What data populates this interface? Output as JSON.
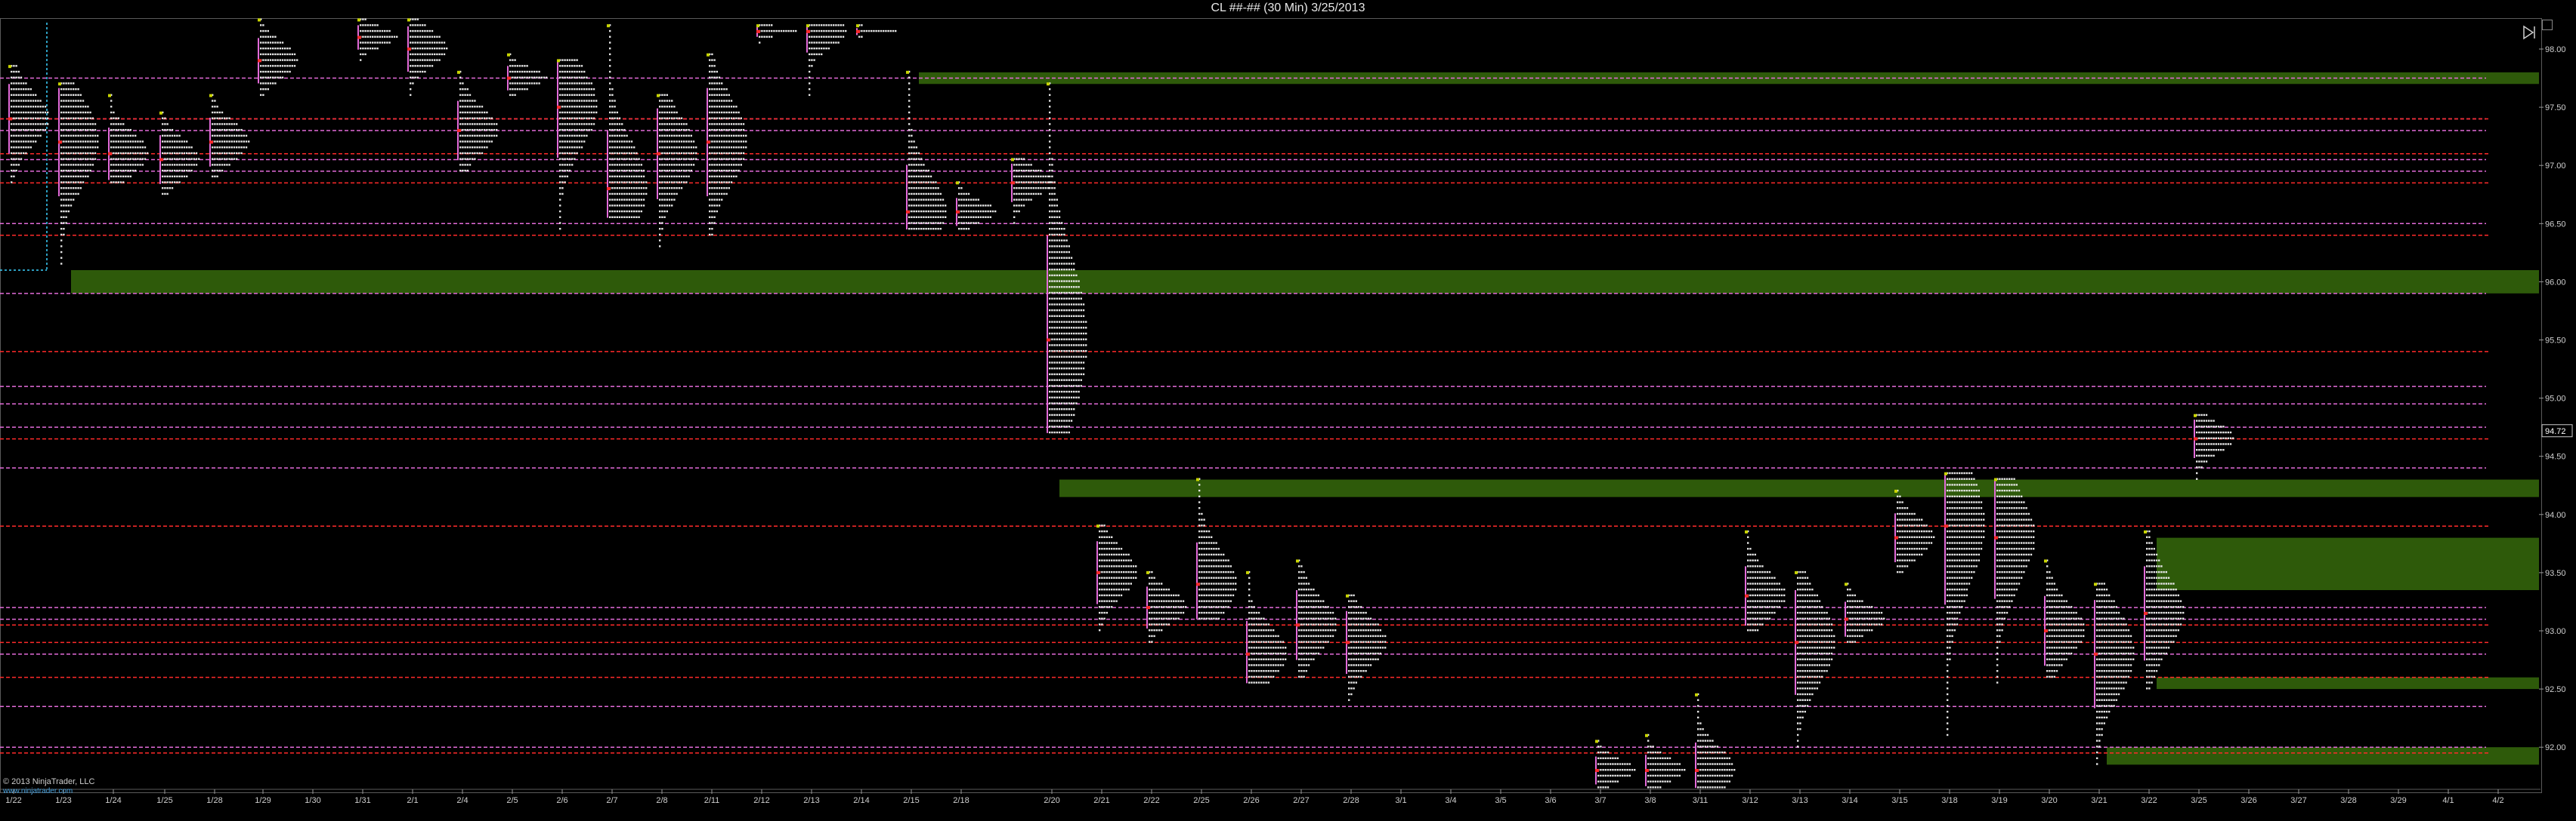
{
  "window": {
    "title": "CL ##-## (30 Min)  3/25/2013"
  },
  "footer": {
    "copyright": "© 2013 NinjaTrader, LLC",
    "watermark": "www.ninjatrader.com"
  },
  "colors": {
    "background": "#000000",
    "dots": "#e6e6e6",
    "poc": "#ff2a2a",
    "value_area": "#e36bd9",
    "range_band": "#2e5a0a",
    "open_tick": "#c8d400",
    "grid": "#5a5a5a"
  },
  "chart_data": {
    "type": "market_profile",
    "instrument": "CL ##-##",
    "interval": "30 Min",
    "date": "3/25/2013",
    "y_axis": {
      "ticks": [
        "98.00",
        "97.50",
        "97.00",
        "96.50",
        "96.00",
        "95.50",
        "95.00",
        "94.50",
        "94.00",
        "93.50",
        "93.00",
        "92.50",
        "92.00"
      ],
      "ylim": [
        91.65,
        98.2
      ]
    },
    "current_price": "94.72",
    "x_axis": {
      "labels": [
        "1/22",
        "1/23",
        "1/24",
        "1/25",
        "1/28",
        "1/29",
        "1/30",
        "1/31",
        "2/1",
        "2/4",
        "2/5",
        "2/6",
        "2/7",
        "2/8",
        "2/11",
        "2/12",
        "2/13",
        "2/14",
        "2/15",
        "2/18",
        "2/20",
        "2/21",
        "2/22",
        "2/25",
        "2/26",
        "2/27",
        "2/28",
        "3/1",
        "3/4",
        "3/5",
        "3/6",
        "3/7",
        "3/8",
        "3/11",
        "3/12",
        "3/13",
        "3/14",
        "3/15",
        "3/18",
        "3/19",
        "3/20",
        "3/21",
        "3/22",
        "3/25",
        "3/26",
        "3/27",
        "3/28",
        "3/29",
        "4/1",
        "4/2"
      ]
    },
    "profiles": [
      {
        "date": "1/22",
        "low": 96.85,
        "high": 97.85,
        "poc": 97.4
      },
      {
        "date": "1/23",
        "low": 96.15,
        "high": 97.7,
        "poc": 97.2
      },
      {
        "date": "1/24",
        "low": 96.85,
        "high": 97.6,
        "poc": 97.1
      },
      {
        "date": "1/25",
        "low": 96.75,
        "high": 97.45,
        "poc": 97.05
      },
      {
        "date": "1/28",
        "low": 96.9,
        "high": 97.6,
        "poc": 97.2
      },
      {
        "date": "1/29",
        "low": 97.6,
        "high": 98.25,
        "poc": 97.9
      },
      {
        "date": "1/31",
        "low": 97.9,
        "high": 98.25,
        "poc": 98.1
      },
      {
        "date": "2/1",
        "low": 97.6,
        "high": 98.25,
        "poc": 98.0
      },
      {
        "date": "2/4",
        "low": 96.95,
        "high": 97.8,
        "poc": 97.3
      },
      {
        "date": "2/5",
        "low": 97.6,
        "high": 97.95,
        "poc": 97.75
      },
      {
        "date": "2/6",
        "low": 96.45,
        "high": 97.9,
        "poc": 97.5
      },
      {
        "date": "2/7",
        "low": 96.55,
        "high": 98.2,
        "poc": 96.8
      },
      {
        "date": "2/8",
        "low": 96.3,
        "high": 97.6,
        "poc": 97.1
      },
      {
        "date": "2/11",
        "low": 96.4,
        "high": 97.95,
        "poc": 97.2
      },
      {
        "date": "2/12",
        "low": 98.05,
        "high": 98.2,
        "poc": 98.15
      },
      {
        "date": "2/13",
        "low": 97.6,
        "high": 98.2,
        "poc": 98.15
      },
      {
        "date": "2/14",
        "low": 98.1,
        "high": 98.2,
        "poc": 98.15
      },
      {
        "date": "2/15",
        "low": 96.45,
        "high": 97.8,
        "poc": 96.6
      },
      {
        "date": "2/18",
        "low": 96.45,
        "high": 96.85,
        "poc": 96.6
      },
      {
        "date": "2/19",
        "low": 96.5,
        "high": 97.05,
        "poc": 96.85
      },
      {
        "date": "2/20",
        "low": 94.7,
        "high": 97.7,
        "poc": 95.5
      },
      {
        "date": "2/21",
        "low": 93.0,
        "high": 93.9,
        "poc": 93.5
      },
      {
        "date": "2/22",
        "low": 92.9,
        "high": 93.5,
        "poc": 93.2
      },
      {
        "date": "2/25",
        "low": 93.1,
        "high": 94.3,
        "poc": 93.4
      },
      {
        "date": "2/26",
        "low": 92.55,
        "high": 93.5,
        "poc": 92.8
      },
      {
        "date": "2/27",
        "low": 92.6,
        "high": 93.6,
        "poc": 93.05
      },
      {
        "date": "2/28",
        "low": 92.4,
        "high": 93.3,
        "poc": 92.9
      },
      {
        "date": "3/7",
        "low": 91.65,
        "high": 92.05,
        "poc": 91.8
      },
      {
        "date": "3/8",
        "low": 91.65,
        "high": 92.1,
        "poc": 91.8
      },
      {
        "date": "3/11",
        "low": 91.65,
        "high": 92.45,
        "poc": 91.8
      },
      {
        "date": "3/12",
        "low": 93.0,
        "high": 93.85,
        "poc": 93.3
      },
      {
        "date": "3/13",
        "low": 92.0,
        "high": 93.5,
        "poc": 92.9
      },
      {
        "date": "3/14",
        "low": 92.9,
        "high": 93.4,
        "poc": 93.1
      },
      {
        "date": "3/15",
        "low": 93.5,
        "high": 94.2,
        "poc": 93.8
      },
      {
        "date": "3/18",
        "low": 92.1,
        "high": 94.35,
        "poc": 93.9
      },
      {
        "date": "3/19",
        "low": 92.55,
        "high": 94.3,
        "poc": 93.8
      },
      {
        "date": "3/20",
        "low": 92.6,
        "high": 93.6,
        "poc": 93.0
      },
      {
        "date": "3/21",
        "low": 91.85,
        "high": 93.4,
        "poc": 92.8
      },
      {
        "date": "3/22",
        "low": 92.5,
        "high": 93.85,
        "poc": 93.15
      },
      {
        "date": "3/25",
        "low": 94.3,
        "high": 94.85,
        "poc": 94.65
      }
    ],
    "value_area_lines": [
      {
        "price": 97.75
      },
      {
        "price": 97.4
      },
      {
        "price": 97.3
      },
      {
        "price": 97.05
      },
      {
        "price": 96.95
      },
      {
        "price": 96.5
      },
      {
        "price": 95.9
      },
      {
        "price": 95.1
      },
      {
        "price": 94.75
      },
      {
        "price": 94.4
      },
      {
        "price": 94.95
      },
      {
        "price": 93.2
      },
      {
        "price": 93.1
      },
      {
        "price": 92.8
      },
      {
        "price": 92.35
      },
      {
        "price": 92.0
      }
    ],
    "poc_lines": [
      {
        "price": 97.4
      },
      {
        "price": 97.1
      },
      {
        "price": 96.85
      },
      {
        "price": 96.4
      },
      {
        "price": 95.4
      },
      {
        "price": 94.65
      },
      {
        "price": 93.9
      },
      {
        "price": 93.05
      },
      {
        "price": 92.9
      },
      {
        "price": 92.6
      },
      {
        "price": 91.95
      }
    ],
    "range_bands": [
      {
        "from_date": "2/15",
        "low": 97.7,
        "high": 97.8
      },
      {
        "from_date": "1/23",
        "low": 95.9,
        "high": 96.1
      },
      {
        "from_date": "2/20",
        "low": 94.15,
        "high": 94.3
      },
      {
        "from_date": "3/22",
        "low": 93.35,
        "high": 93.8
      },
      {
        "from_date": "3/22",
        "low": 92.5,
        "high": 92.6
      },
      {
        "from_date": "3/21",
        "low": 91.85,
        "high": 92.0
      }
    ]
  }
}
